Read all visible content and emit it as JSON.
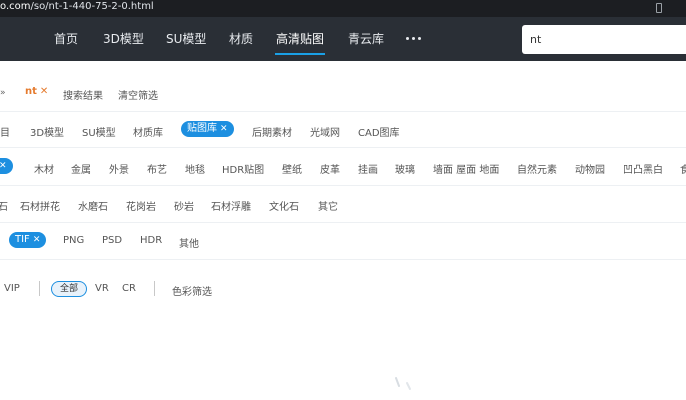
{
  "browser": {
    "url_domain": "o.com",
    "url_path": "/so/nt-1-440-75-2-0.html"
  },
  "nav": {
    "items": [
      "首页",
      "3D模型",
      "SU模型",
      "材质",
      "高清贴图",
      "青云库"
    ],
    "active": "高清贴图",
    "more": "···"
  },
  "search": {
    "value": "nt"
  },
  "crumbs": {
    "arrow": "»",
    "term": "nt",
    "close": "✕",
    "results": "搜索结果",
    "clear": "清空筛选"
  },
  "categories": {
    "items": [
      "目",
      "3D模型",
      "SU模型",
      "材质库",
      "贴图库",
      "后期素材",
      "光域网",
      "CAD图库"
    ],
    "selected": "贴图库"
  },
  "subcategories": {
    "items": [
      "木材",
      "金属",
      "外景",
      "布艺",
      "地毯",
      "HDR贴图",
      "壁纸",
      "皮革",
      "挂画",
      "玻璃",
      "墙面 屋面 地面",
      "自然元素",
      "动物园",
      "凹凸黑白",
      "食"
    ]
  },
  "stone_types": {
    "items": [
      "石",
      "石材拼花",
      "水磨石",
      "花岗岩",
      "砂岩",
      "石材浮雕",
      "文化石",
      "其它"
    ]
  },
  "formats": {
    "selected": "TIF",
    "items": [
      "PNG",
      "PSD",
      "HDR",
      "其他"
    ]
  },
  "extras": {
    "vip": "VIP",
    "all": "全部",
    "vr": "VR",
    "cr": "CR",
    "color_filter": "色彩筛选"
  },
  "colors": {
    "accent": "#1d8fe0",
    "header_bg": "#2a2f36",
    "term": "#e57b2e"
  }
}
